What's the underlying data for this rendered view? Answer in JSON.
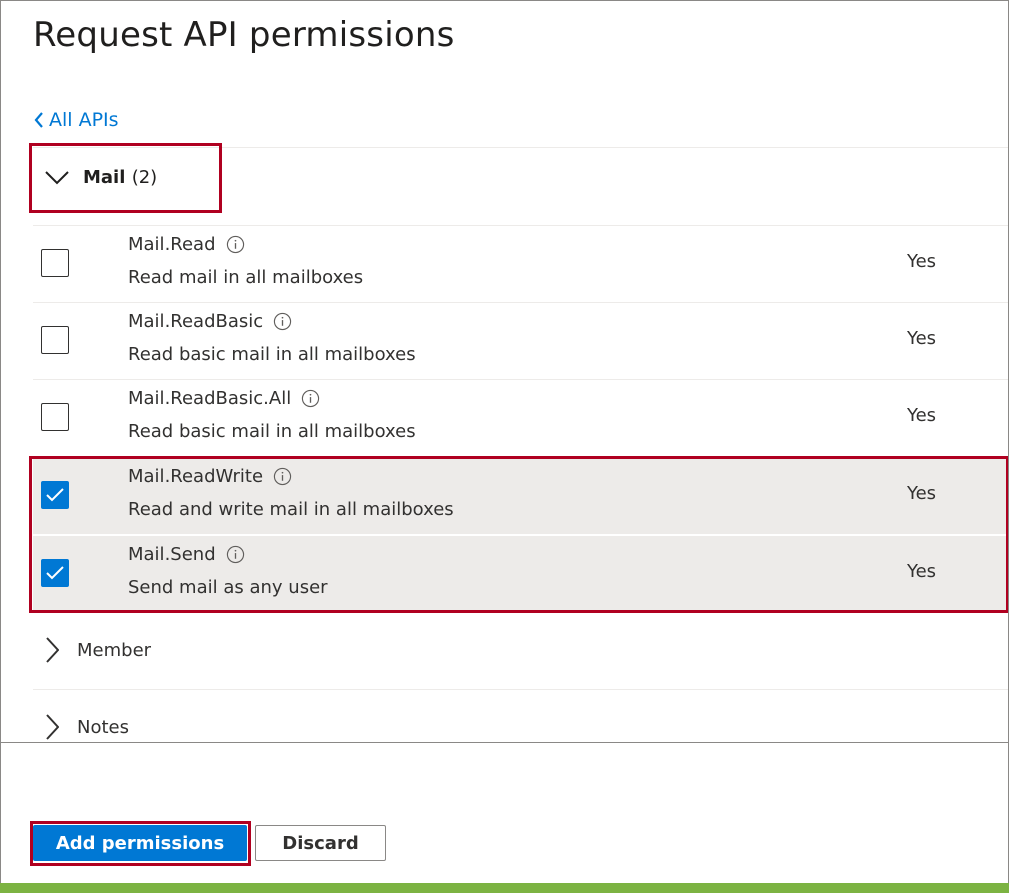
{
  "panel": {
    "title": "Request API permissions",
    "back_link": "All APIs"
  },
  "mail_group": {
    "name": "Mail",
    "count": "(2)",
    "expanded": true,
    "permissions": [
      {
        "name": "Mail.Read",
        "description": "Read mail in all mailboxes",
        "admin_consent": "Yes",
        "checked": false
      },
      {
        "name": "Mail.ReadBasic",
        "description": "Read basic mail in all mailboxes",
        "admin_consent": "Yes",
        "checked": false
      },
      {
        "name": "Mail.ReadBasic.All",
        "description": "Read basic mail in all mailboxes",
        "admin_consent": "Yes",
        "checked": false
      },
      {
        "name": "Mail.ReadWrite",
        "description": "Read and write mail in all mailboxes",
        "admin_consent": "Yes",
        "checked": true
      },
      {
        "name": "Mail.Send",
        "description": "Send mail as any user",
        "admin_consent": "Yes",
        "checked": true
      }
    ]
  },
  "collapsed_groups": [
    {
      "name": "Member"
    },
    {
      "name": "Notes"
    }
  ],
  "footer": {
    "add_label": "Add permissions",
    "discard_label": "Discard"
  },
  "colors": {
    "accent": "#0078d4",
    "highlight_border": "#b00020",
    "selected_row": "#edebe9",
    "bottom_strip": "#7cb342"
  },
  "icons": {
    "back": "chevron-left-icon",
    "expanded": "chevron-down-icon",
    "collapsed": "chevron-right-icon",
    "info": "info-icon",
    "check": "checkmark-icon"
  }
}
